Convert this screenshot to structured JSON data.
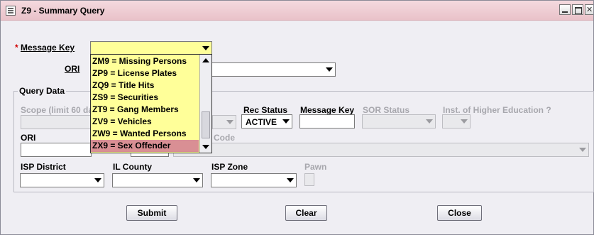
{
  "window": {
    "title": "Z9 - Summary Query",
    "icon": "window-list-icon",
    "controls": [
      "minimize-icon",
      "maximize-icon",
      "close-icon"
    ]
  },
  "top_form": {
    "required_marker": "*",
    "message_key_label": "Message Key",
    "message_key_value": "",
    "ori_label": "ORI",
    "ori_value": ""
  },
  "message_key_options": [
    "ZM9 = Missing Persons",
    "ZP9 = License Plates",
    "ZQ9 = Title Hits",
    "ZS9 = Securities",
    "ZT9 = Gang Members",
    "ZV9 = Vehicles",
    "ZW9 = Wanted Persons",
    "ZX9 = Sex Offender"
  ],
  "highlighted_option": "ZX9 = Sex Offender",
  "query_data": {
    "group_title": "Query Data",
    "scope_label": "Scope (limit 60 da",
    "rec_status_label": "Rec Status",
    "rec_status_value": "ACTIVE",
    "message_key_label": "Message Key",
    "sor_status_label": "SOR Status",
    "higher_ed_label": "Inst. of Higher Education ?",
    "ori_label": "ORI",
    "code_label": "Code",
    "isp_district_label": "ISP District",
    "il_county_label": "IL County",
    "isp_zone_label": "ISP Zone",
    "pawn_label": "Pawn"
  },
  "buttons": {
    "submit": "Submit",
    "clear": "Clear",
    "close": "Close"
  },
  "colors": {
    "titlebar": "#e9c2c9",
    "dropdown_bg": "#ffff99",
    "selected_option": "#d98f94",
    "required": "#d00000"
  }
}
